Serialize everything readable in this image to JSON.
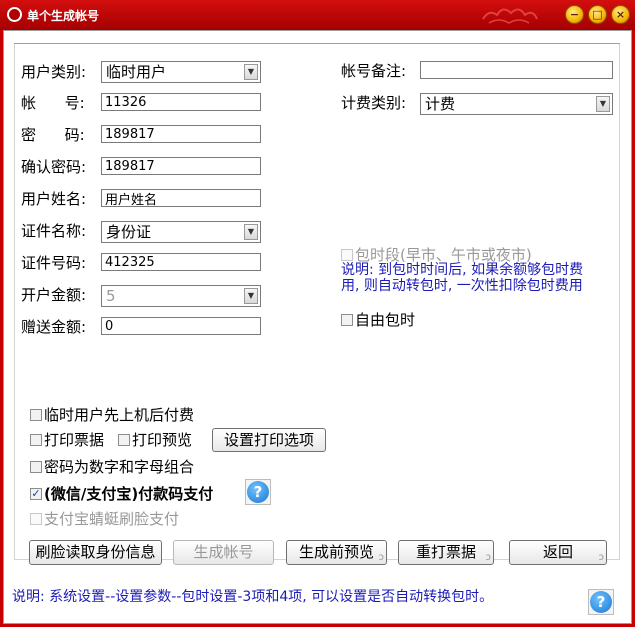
{
  "window": {
    "title": "单个生成帐号",
    "minimize": "−",
    "maximize": "□",
    "close": "×"
  },
  "left": {
    "user_type": {
      "label": "用户类别:",
      "value": "临时用户"
    },
    "account": {
      "label": "帐      号:",
      "value": "11326"
    },
    "password": {
      "label": "密      码:",
      "value": "189817"
    },
    "confirm_password": {
      "label": "确认密码:",
      "value": "189817"
    },
    "user_name": {
      "label": "用户姓名:",
      "value": "用户姓名"
    },
    "id_type": {
      "label": "证件名称:",
      "value": "身份证"
    },
    "id_number": {
      "label": "证件号码:",
      "value": "412325"
    },
    "open_amount": {
      "label": "开户金额:",
      "value": "5"
    },
    "gift_amount": {
      "label": "赠送金额:",
      "value": "0"
    }
  },
  "right": {
    "account_note": {
      "label": "帐号备注:",
      "value": ""
    },
    "billing_type": {
      "label": "计费类别:",
      "value": "计费"
    },
    "package_period": {
      "label": "包时段(早市、午市或夜市)",
      "checked": false
    },
    "package_note": "说明: 到包时时间后, 如果余额够包时费用, 则自动转包时, 一次性扣除包时费用",
    "free_package": {
      "label": "自由包时",
      "checked": false
    }
  },
  "options": {
    "temp_pay_after": {
      "label": "临时用户先上机后付费",
      "checked": false
    },
    "print_ticket": {
      "label": "打印票据",
      "checked": false
    },
    "print_preview": {
      "label": "打印预览",
      "checked": false
    },
    "print_settings_button": "设置打印选项",
    "password_alnum": {
      "label": "密码为数字和字母组合",
      "checked": false
    },
    "wechat_alipay": {
      "label": "(微信/支付宝)付款码支付",
      "checked": true
    },
    "alipay_face": {
      "label": "支付宝蜻蜓刷脸支付",
      "checked": false
    }
  },
  "buttons": {
    "read_id": "刷脸读取身份信息",
    "generate": "生成帐号",
    "preview": "生成前预览",
    "reprint": "重打票据",
    "back": "返回"
  },
  "footer_note": "说明: 系统设置--设置参数--包时设置-3项和4项, 可以设置是否自动转换包时。",
  "icons": {
    "help": "?",
    "checkmark": "✓",
    "dropdown": "▼",
    "curl": "ↄ"
  },
  "colors": {
    "title_bar": "#c60000",
    "note_text": "#1c1cb8",
    "help_icon": "#1976d2"
  }
}
